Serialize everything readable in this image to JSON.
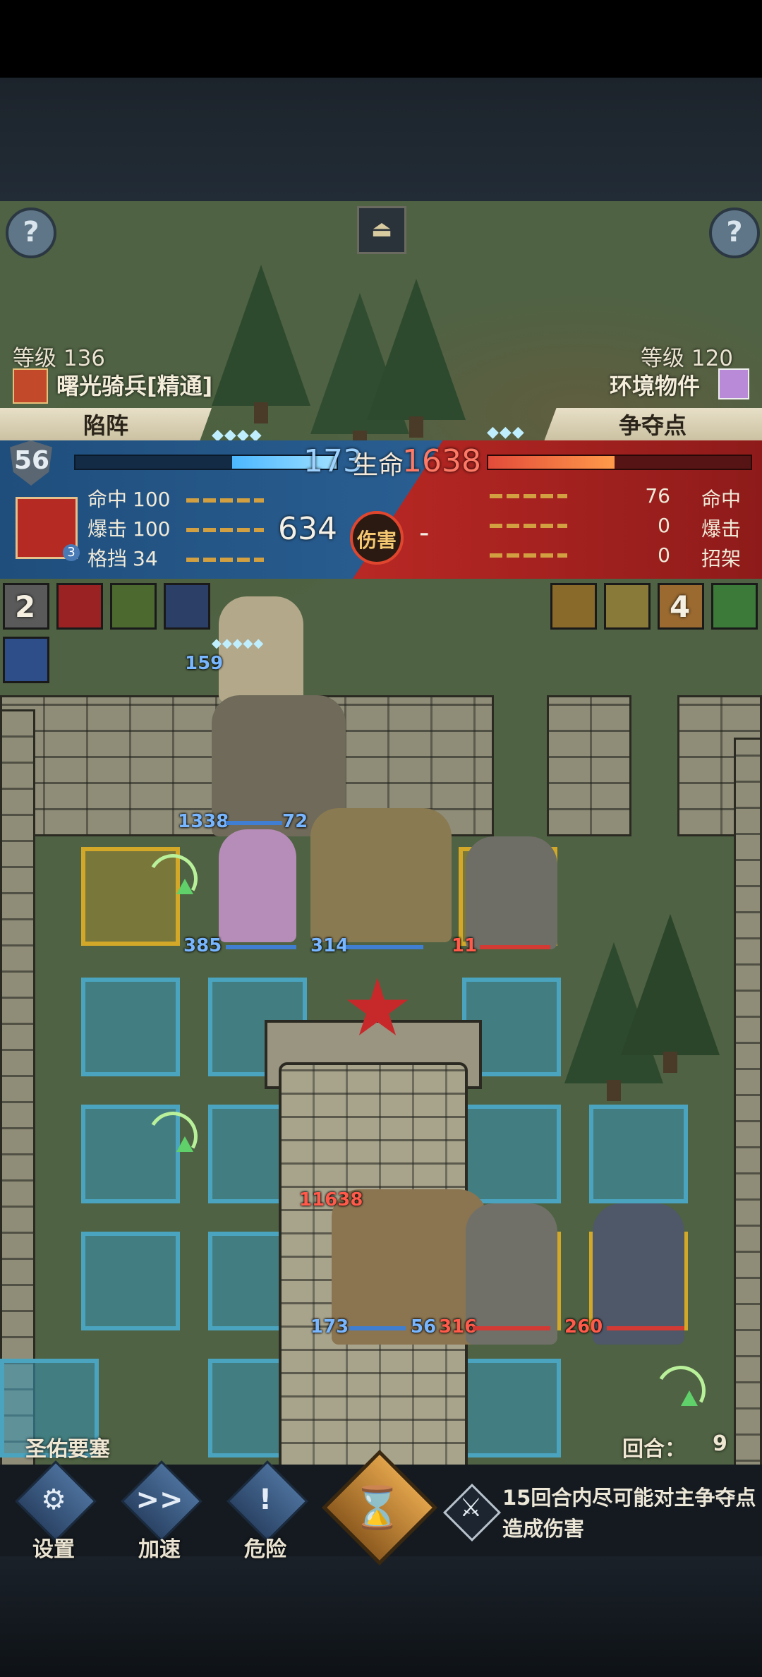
{
  "header": {
    "help_left": "?",
    "help_right": "?",
    "toggle_icon": "⏏",
    "left_level": "等级 136",
    "right_level": "等级 120",
    "left_name": "曙光骑兵[精通]",
    "right_name": "环境物件",
    "left_tag": "陷阵",
    "right_tag": "争夺点"
  },
  "combat": {
    "shield_value": "56",
    "hp_left": "173",
    "hp_label": "生命",
    "hp_right": "1638",
    "hp_left_fraction": 0.4,
    "hp_right_fraction": 0.48,
    "left_stats": [
      {
        "label": "命中",
        "value": "100"
      },
      {
        "label": "爆击",
        "value": "100"
      },
      {
        "label": "格挡",
        "value": "34"
      }
    ],
    "right_stats": [
      {
        "label": "命中",
        "value": "76"
      },
      {
        "label": "爆击",
        "value": "0"
      },
      {
        "label": "招架",
        "value": "0"
      }
    ],
    "damage_value": "634",
    "damage_label": "伤害",
    "damage_right": "-",
    "skill_badge": "3"
  },
  "buffs": {
    "left_count": "2",
    "right_count": "4"
  },
  "battlefield": {
    "unit_numbers": [
      {
        "text": "159",
        "color": "blue"
      },
      {
        "text": "1338",
        "color": "blue"
      },
      {
        "text": "72",
        "color": "blue"
      },
      {
        "text": "385",
        "color": "blue"
      },
      {
        "text": "314",
        "color": "blue"
      },
      {
        "text": "11",
        "color": "red"
      },
      {
        "text": "11638",
        "color": "red"
      },
      {
        "text": "173",
        "color": "blue"
      },
      {
        "text": "56",
        "color": "blue"
      },
      {
        "text": "316",
        "color": "red"
      },
      {
        "text": "260",
        "color": "red"
      }
    ]
  },
  "footer": {
    "fortress_name": "圣佑要塞",
    "round_label": "回合：",
    "round_value": "9"
  },
  "bottom_bar": {
    "settings_label": "设置",
    "speed_label": "加速",
    "danger_label": "危险",
    "settings_icon": "⚙",
    "speed_icon": ">>",
    "danger_icon": "!",
    "hourglass_icon": "⌛",
    "objective_icon": "⚔",
    "objective_line1": "15回合内尽可能对主争夺点",
    "objective_line2": "造成伤害"
  }
}
